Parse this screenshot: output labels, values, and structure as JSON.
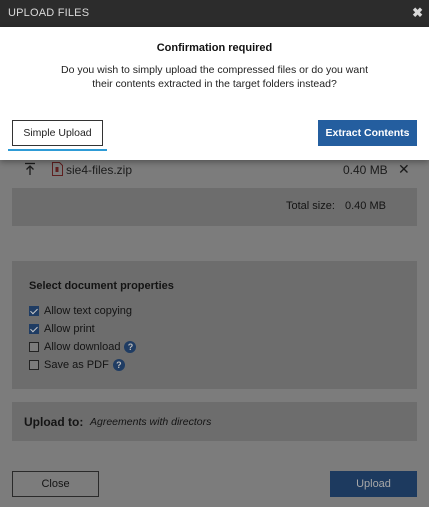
{
  "window": {
    "title": "UPLOAD FILES",
    "close_glyph": "✖"
  },
  "confirm": {
    "title": "Confirmation required",
    "message": "Do you wish to simply upload the compressed files or do you want their contents extracted in the target folders instead?",
    "simple_label": "Simple Upload",
    "extract_label": "Extract Contents"
  },
  "files": [
    {
      "name": "sie4-files.zip",
      "size": "0.40 MB",
      "icon": "zip-file-icon"
    }
  ],
  "total": {
    "label": "Total size:",
    "value": "0.40 MB"
  },
  "properties": {
    "header": "Select document properties",
    "options": [
      {
        "label": "Allow text copying",
        "checked": true,
        "help": false
      },
      {
        "label": "Allow print",
        "checked": true,
        "help": false
      },
      {
        "label": "Allow download",
        "checked": false,
        "help": true
      },
      {
        "label": "Save as PDF",
        "checked": false,
        "help": true
      }
    ]
  },
  "upload_to": {
    "label": "Upload to:",
    "destination": "Agreements with directors"
  },
  "footer": {
    "close_label": "Close",
    "upload_label": "Upload"
  },
  "colors": {
    "accent": "#245e9f",
    "focus": "#2e9bd6",
    "titlebar": "#2c2c2c",
    "overlay": "#7c7c7c"
  }
}
